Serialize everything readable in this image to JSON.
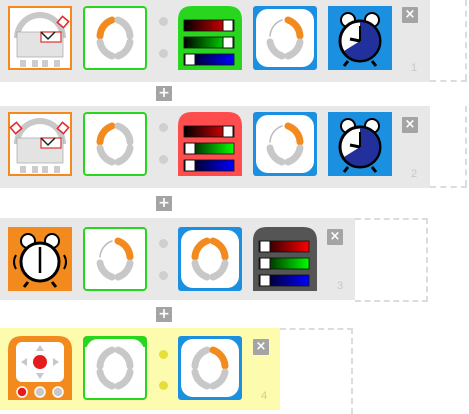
{
  "rows": [
    {
      "number": "1",
      "blocks": [
        "grid-sensor-block",
        "turn-move-block",
        "rgb-slider-block",
        "turn-move-block",
        "alarm-clock-block"
      ]
    },
    {
      "number": "2",
      "blocks": [
        "grid-sensor-block",
        "turn-move-block",
        "rgb-slider-block",
        "turn-move-block",
        "alarm-clock-block"
      ]
    },
    {
      "number": "3",
      "blocks": [
        "alarm-ring-block",
        "turn-move-block",
        "turn-move-block",
        "rgb-slider-block"
      ]
    },
    {
      "number": "4",
      "blocks": [
        "remote-control-block",
        "idle-move-block",
        "turn-move-block"
      ]
    }
  ],
  "colors": {
    "orange": "#f28a1e",
    "green": "#27d61d",
    "blue": "#1b8fe0",
    "row_bg": "#e8e8e8",
    "row4_bg": "#fdfcae",
    "red": "#ff4040",
    "navy": "#22309c"
  },
  "buttons": {
    "close": "×",
    "add": "+"
  }
}
